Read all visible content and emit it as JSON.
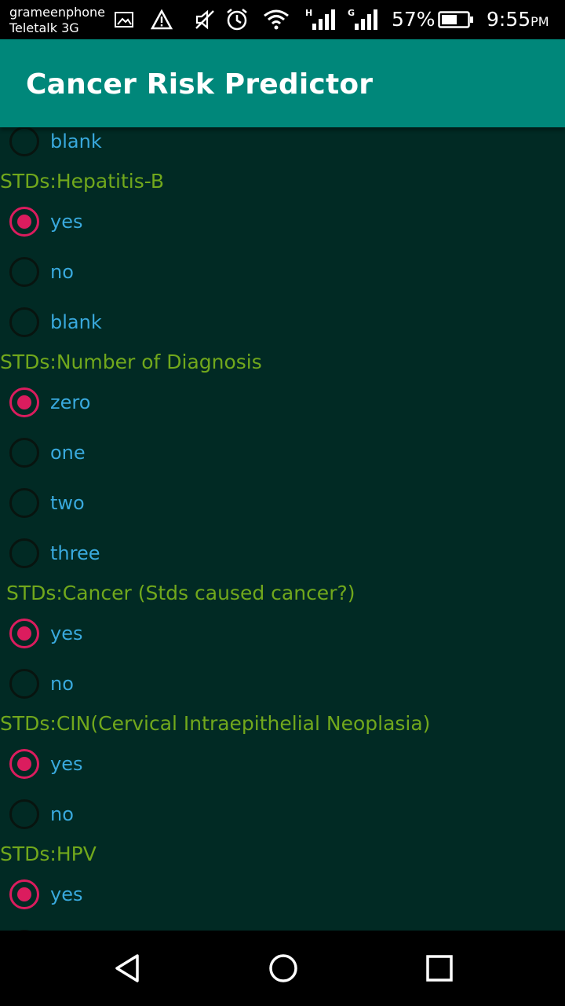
{
  "status_bar": {
    "carrier_1": "grameenphone",
    "carrier_2": "Teletalk 3G",
    "network_1_type": "H",
    "network_2_type": "G",
    "battery_percent": "57%",
    "time": "9:55",
    "time_suffix": "PM",
    "icons": [
      "image-icon",
      "warning-icon",
      "mute-icon",
      "alarm-icon",
      "wifi-icon",
      "signal-icon",
      "signal-icon",
      "battery-icon"
    ]
  },
  "app_bar": {
    "title": "Cancer Risk Predictor",
    "background_color": "#00877a"
  },
  "form": {
    "partial_option": {
      "label": "blank",
      "checked": false
    },
    "questions": [
      {
        "label": "STDs:Hepatitis-B",
        "options": [
          {
            "label": "yes",
            "checked": true
          },
          {
            "label": "no",
            "checked": false
          },
          {
            "label": "blank",
            "checked": false
          }
        ]
      },
      {
        "label": "STDs:Number of Diagnosis",
        "options": [
          {
            "label": "zero",
            "checked": true
          },
          {
            "label": "one",
            "checked": false
          },
          {
            "label": "two",
            "checked": false
          },
          {
            "label": "three",
            "checked": false
          }
        ]
      },
      {
        "label": " STDs:Cancer (Stds caused cancer?)",
        "options": [
          {
            "label": "yes",
            "checked": true
          },
          {
            "label": "no",
            "checked": false
          }
        ]
      },
      {
        "label": "STDs:CIN(Cervical Intraepithelial Neoplasia)",
        "options": [
          {
            "label": "yes",
            "checked": true
          },
          {
            "label": "no",
            "checked": false
          }
        ]
      },
      {
        "label": "STDs:HPV",
        "options": [
          {
            "label": "yes",
            "checked": true
          }
        ]
      }
    ]
  },
  "colors": {
    "background": "#012a24",
    "question_text": "#71a81c",
    "option_text": "#39a9dd",
    "radio_accent": "#db1c5e"
  },
  "nav_bar": {
    "buttons": [
      "back-icon",
      "home-icon",
      "recents-icon"
    ]
  }
}
